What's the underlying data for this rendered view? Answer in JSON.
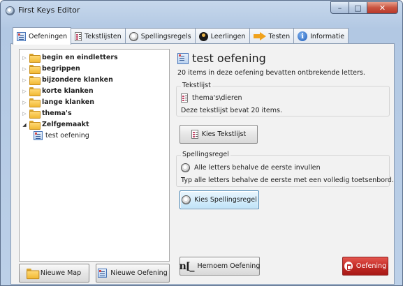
{
  "window": {
    "title": "First Keys Editor"
  },
  "caption": {
    "minimize": "–",
    "maximize": "□",
    "close": "✕"
  },
  "tabs": [
    {
      "label": "Oefeningen",
      "icon": "sheet-icon"
    },
    {
      "label": "Tekstlijsten",
      "icon": "doc-icon"
    },
    {
      "label": "Spellingsregels",
      "icon": "stamp-icon"
    },
    {
      "label": "Leerlingen",
      "icon": "person-icon"
    },
    {
      "label": "Testen",
      "icon": "arrow-right-icon"
    },
    {
      "label": "Informatie",
      "icon": "info-icon"
    }
  ],
  "tree": {
    "items": [
      {
        "label": "begin en eindletters"
      },
      {
        "label": "begrippen"
      },
      {
        "label": "bijzondere klanken"
      },
      {
        "label": "korte klanken"
      },
      {
        "label": "lange klanken"
      },
      {
        "label": "thema's"
      },
      {
        "label": "Zelfgemaakt",
        "expanded": true
      },
      {
        "label": "test oefening",
        "child": true
      }
    ]
  },
  "buttons": {
    "new_folder": "Nieuwe Map",
    "new_exercise": "Nieuwe Oefening",
    "choose_textlist": "Kies Tekstlijst",
    "choose_rule": "Kies Spellingsregel",
    "rename": "Hernoem Oefening",
    "delete": "Oefening"
  },
  "exercise": {
    "title": "test oefening",
    "description": "20 items in deze oefening bevatten ontbrekende letters.",
    "textlist_group": "Tekstlijst",
    "textlist_name": "thema's\\dieren",
    "textlist_info": "Deze tekstlijst bevat 20 items.",
    "rule_group": "Spellingsregel",
    "rule_name": "Alle letters behalve de eerste invullen",
    "rule_info": "Typ alle letters behalve de eerste met een volledig toetsenbord."
  },
  "icons": {
    "rename_glyph": "n[_"
  }
}
